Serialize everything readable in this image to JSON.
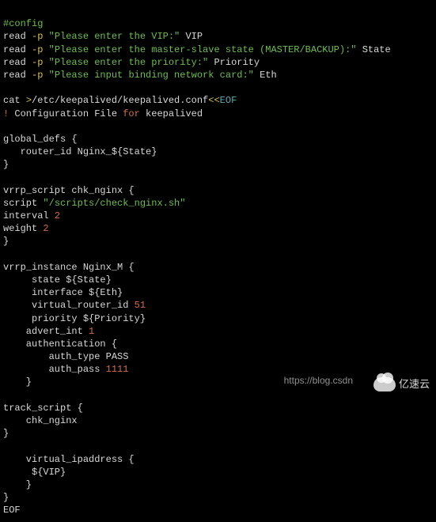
{
  "c": {
    "l1": "#config",
    "l2a": "read ",
    "l2b": "-p ",
    "l2c": "\"Please enter the VIP:\"",
    "l2d": " VIP",
    "l3a": "read ",
    "l3b": "-p ",
    "l3c": "\"Please enter the master-slave state (MASTER/BACKUP):\"",
    "l3d": " State",
    "l4a": "read ",
    "l4b": "-p ",
    "l4c": "\"Please enter the priority:\"",
    "l4d": " Priority",
    "l5a": "read ",
    "l5b": "-p ",
    "l5c": "\"Please input binding network card:\"",
    "l5d": " Eth",
    "l6a": "cat ",
    "l6b": ">",
    "l6c": "/etc/keepalived/keepalived.conf",
    "l6d": "<<",
    "l6e": "EOF",
    "l7a": "! ",
    "l7b": "Configuration File ",
    "l7c": "for",
    "l7d": " keepalived",
    "l8": "global_defs {",
    "l9": "   router_id Nginx_${State}",
    "l10": "}",
    "l11": "vrrp_script chk_nginx {",
    "l12a": "script ",
    "l12b": "\"/scripts/check_nginx.sh\"",
    "l13a": "interval ",
    "l13b": "2",
    "l14a": "weight ",
    "l14b": "2",
    "l15": "}",
    "l16": "vrrp_instance Nginx_M {",
    "l17": "     state ${State}",
    "l18": "     interface ${Eth}",
    "l19a": "     virtual_router_id ",
    "l19b": "51",
    "l20": "     priority ${Priority}",
    "l21a": "    advert_int ",
    "l21b": "1",
    "l22": "    authentication {",
    "l23": "        auth_type PASS",
    "l24a": "        auth_pass ",
    "l24b": "1111",
    "l25": "    }",
    "l26": "track_script {",
    "l27": "    chk_nginx",
    "l28": "}",
    "l29": "    virtual_ipaddress {",
    "l30": "     ${VIP}",
    "l31": "    }",
    "l32": "}",
    "l33": "EOF"
  },
  "watermark": {
    "url": "https://blog.csdn",
    "logo_text": "亿速云"
  }
}
